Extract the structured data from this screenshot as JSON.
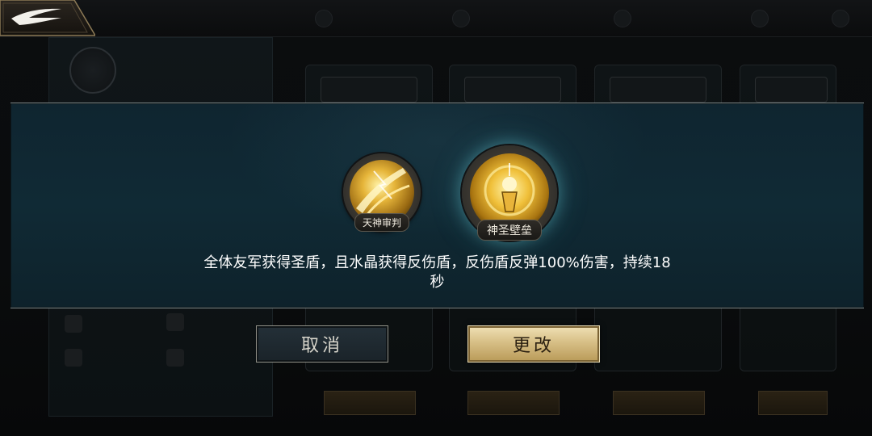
{
  "dialog": {
    "skills": [
      {
        "label": "天神审判",
        "icon": "divine-judgment-skill-icon",
        "selected": false
      },
      {
        "label": "神圣壁垒",
        "icon": "holy-bulwark-skill-icon",
        "selected": true
      }
    ],
    "description_line1": "全体友军获得圣盾，且水晶获得反伤盾，反伤盾反弹100%伤害，持续18",
    "description_line2": "秒",
    "cancel_label": "取消",
    "confirm_label": "更改"
  },
  "colors": {
    "modal_bg": "#0f2530",
    "confirm_button": "#d7bf86",
    "cancel_button": "#1f2a30",
    "selected_glow": "#78dce6"
  }
}
